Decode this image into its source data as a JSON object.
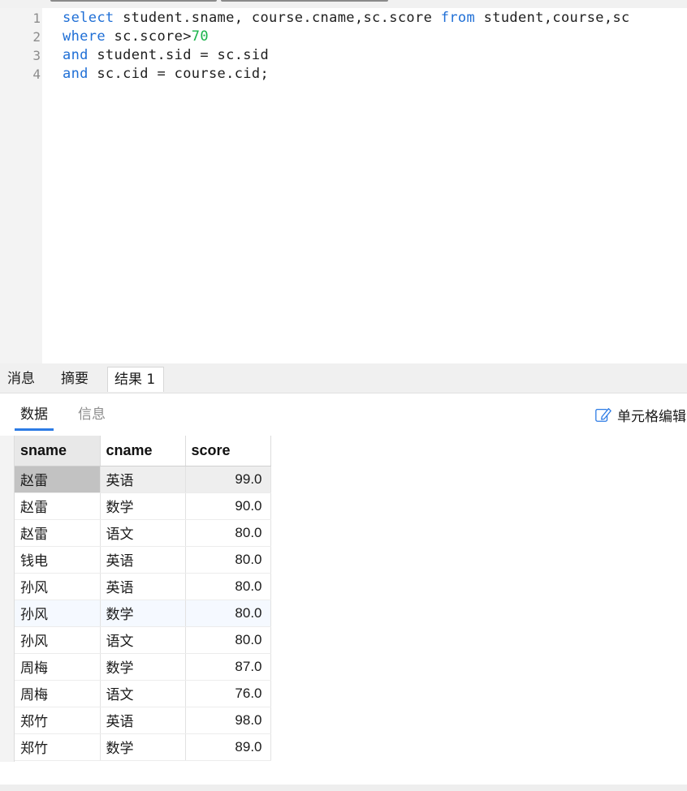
{
  "editor": {
    "lines": [
      {
        "num": "1",
        "tokens": [
          {
            "t": "select",
            "k": "kw"
          },
          {
            "t": " student.sname, course.cname,sc.score ",
            "k": ""
          },
          {
            "t": "from",
            "k": "kw"
          },
          {
            "t": " student,course,sc",
            "k": ""
          }
        ]
      },
      {
        "num": "2",
        "tokens": [
          {
            "t": "where",
            "k": "kw"
          },
          {
            "t": " sc.score>",
            "k": ""
          },
          {
            "t": "70",
            "k": "num"
          }
        ]
      },
      {
        "num": "3",
        "tokens": [
          {
            "t": "and",
            "k": "kw"
          },
          {
            "t": " student.sid = sc.sid",
            "k": ""
          }
        ]
      },
      {
        "num": "4",
        "tokens": [
          {
            "t": "and",
            "k": "kw"
          },
          {
            "t": " sc.cid = course.cid;",
            "k": ""
          }
        ]
      }
    ]
  },
  "result_tabs": {
    "messages": "消息",
    "summary": "摘要",
    "result1": "结果 1"
  },
  "sub_tabs": {
    "data": "数据",
    "info": "信息",
    "cell_editor": "单元格编辑"
  },
  "grid": {
    "columns": [
      "sname",
      "cname",
      "score"
    ],
    "rows": [
      [
        "赵雷",
        "英语",
        "99.0"
      ],
      [
        "赵雷",
        "数学",
        "90.0"
      ],
      [
        "赵雷",
        "语文",
        "80.0"
      ],
      [
        "钱电",
        "英语",
        "80.0"
      ],
      [
        "孙风",
        "英语",
        "80.0"
      ],
      [
        "孙风",
        "数学",
        "80.0"
      ],
      [
        "孙风",
        "语文",
        "80.0"
      ],
      [
        "周梅",
        "数学",
        "87.0"
      ],
      [
        "周梅",
        "语文",
        "76.0"
      ],
      [
        "郑竹",
        "英语",
        "98.0"
      ],
      [
        "郑竹",
        "数学",
        "89.0"
      ]
    ],
    "selected_row": 0,
    "hover_row": 5
  },
  "colors": {
    "keyword": "#1f6fd6",
    "number": "#19b34a",
    "accent": "#2c7be5"
  },
  "icons": {
    "cell_editor": "edit-pencil-icon"
  }
}
